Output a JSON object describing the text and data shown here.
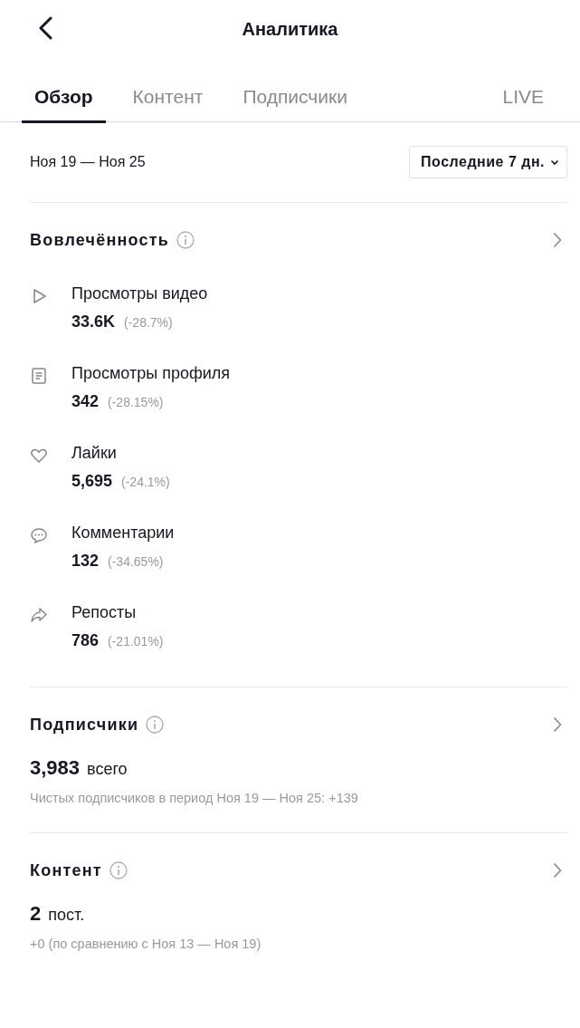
{
  "header": {
    "title": "Аналитика"
  },
  "tabs": [
    {
      "label": "Обзор",
      "selected": true
    },
    {
      "label": "Контент",
      "selected": false
    },
    {
      "label": "Подписчики",
      "selected": false
    },
    {
      "label": "LIVE",
      "selected": false
    }
  ],
  "date_range": "Ноя 19 — Ноя 25",
  "period_dropdown": "Последние 7 дн.",
  "engagement": {
    "title": "Вовлечённость",
    "metrics": [
      {
        "kind": "play",
        "label": "Просмотры видео",
        "value": "33.6K",
        "change": "(-28.7%)"
      },
      {
        "kind": "document",
        "label": "Просмотры профиля",
        "value": "342",
        "change": "(-28.15%)"
      },
      {
        "kind": "heart",
        "label": "Лайки",
        "value": "5,695",
        "change": "(-24.1%)"
      },
      {
        "kind": "comment",
        "label": "Комментарии",
        "value": "132",
        "change": "(-34.65%)"
      },
      {
        "kind": "share",
        "label": "Репосты",
        "value": "786",
        "change": "(-21.01%)"
      }
    ]
  },
  "summaries": [
    {
      "title": "Подписчики",
      "value": "3,983",
      "unit": "всего",
      "note": "Чистых подписчиков в период Ноя 19 — Ноя 25: +139"
    },
    {
      "title": "Контент",
      "value": "2",
      "unit": "пост.",
      "note": "+0 (по сравнению с Ноя 13 — Ноя 19)"
    }
  ]
}
